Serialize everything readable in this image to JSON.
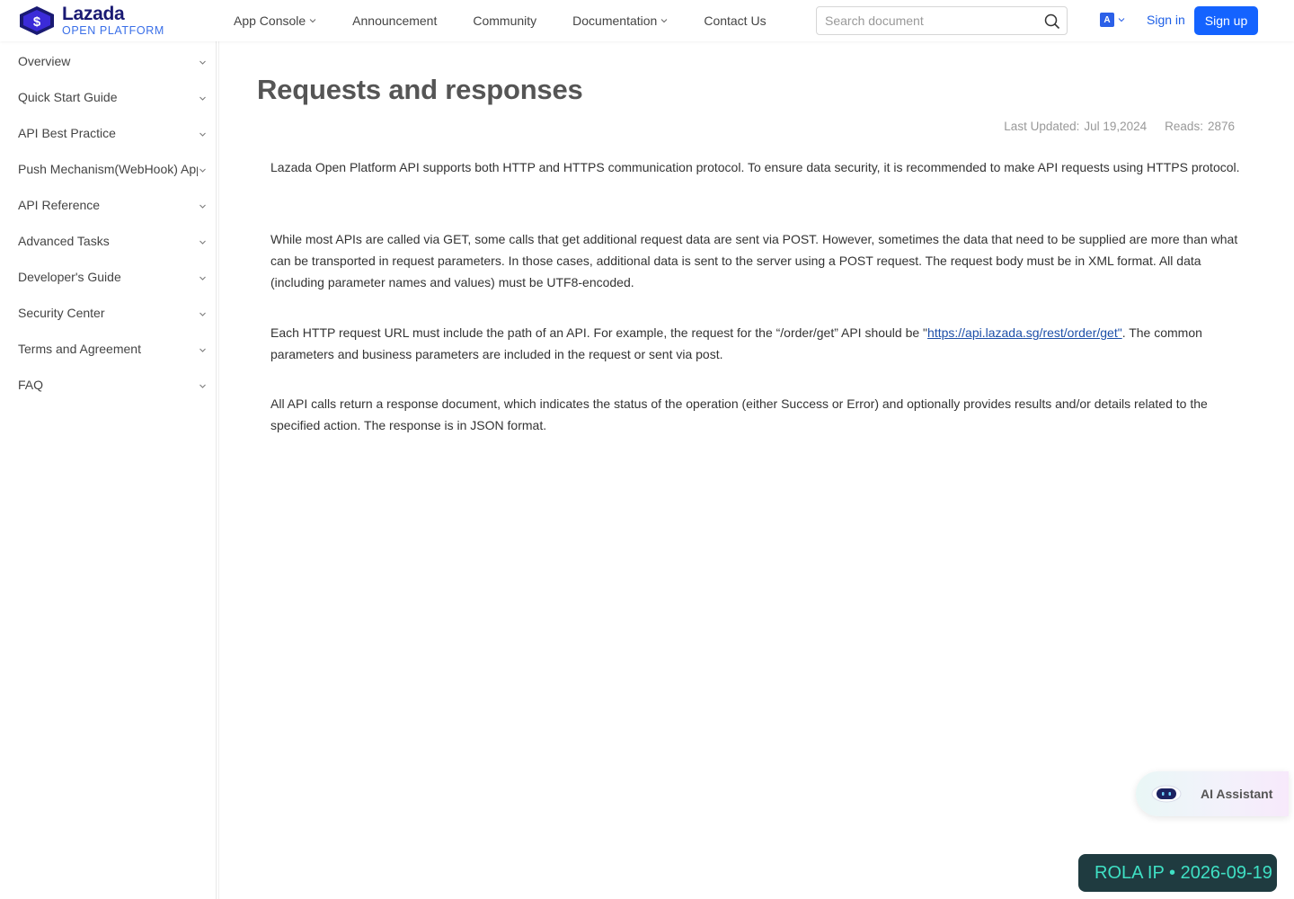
{
  "brand": {
    "name": "Lazada",
    "subtitle": "OPEN PLATFORM",
    "colors": {
      "primary": "#1463ff",
      "logo_dark": "#1a1a73",
      "logo_accent": "#3a6fe8"
    }
  },
  "header": {
    "nav": [
      {
        "label": "App Console",
        "has_dropdown": true
      },
      {
        "label": "Announcement",
        "has_dropdown": false
      },
      {
        "label": "Community",
        "has_dropdown": false
      },
      {
        "label": "Documentation",
        "has_dropdown": true
      },
      {
        "label": "Contact Us",
        "has_dropdown": false
      }
    ],
    "search": {
      "placeholder": "Search document",
      "value": "",
      "icon": "search-icon"
    },
    "language_icon": "A",
    "signin_label": "Sign in",
    "signup_label": "Sign up"
  },
  "sidebar": {
    "items": [
      {
        "label": "Overview"
      },
      {
        "label": "Quick Start Guide"
      },
      {
        "label": "API Best Practice"
      },
      {
        "label": "Push Mechanism(WebHook) App"
      },
      {
        "label": "API Reference"
      },
      {
        "label": "Advanced Tasks"
      },
      {
        "label": "Developer's Guide"
      },
      {
        "label": "Security Center"
      },
      {
        "label": "Terms and Agreement"
      },
      {
        "label": "FAQ"
      }
    ]
  },
  "main": {
    "title": "Requests and responses",
    "meta": {
      "updated_label": "Last Updated:",
      "updated_value": "Jul 19,2024",
      "reads_label": "Reads:",
      "reads_value": "2876"
    },
    "paragraphs": {
      "p1": "Lazada Open Platform API supports both HTTP and HTTPS communication protocol. To ensure data security, it is recommended to make API requests using HTTPS protocol.",
      "p2": "While most APIs are called via GET, some calls that get additional request data are sent via POST. However, sometimes the data that need to be supplied are more than what can be transported in request parameters. In those cases, additional data is sent to the server using a POST request. The request body must be in XML format. All data (including parameter names and values) must be UTF8-encoded.",
      "p3_before": "Each HTTP request URL must include the path of an API. For example, the request for the “/order/get” API should be \"",
      "p3_link": "https://api.lazada.sg/rest/order/get\"",
      "p3_after": ". The common parameters and business parameters are included in the request or sent via post.",
      "p4": "All API calls return a response document, which indicates the status of the operation (either Success or Error) and optionally provides results and/or details related to the specified action. The response is in JSON format."
    }
  },
  "ai_assistant": {
    "label": "AI Assistant",
    "icon": "robot-icon"
  },
  "watermark": {
    "text": "ROLA IP  •  2026-09-19"
  }
}
